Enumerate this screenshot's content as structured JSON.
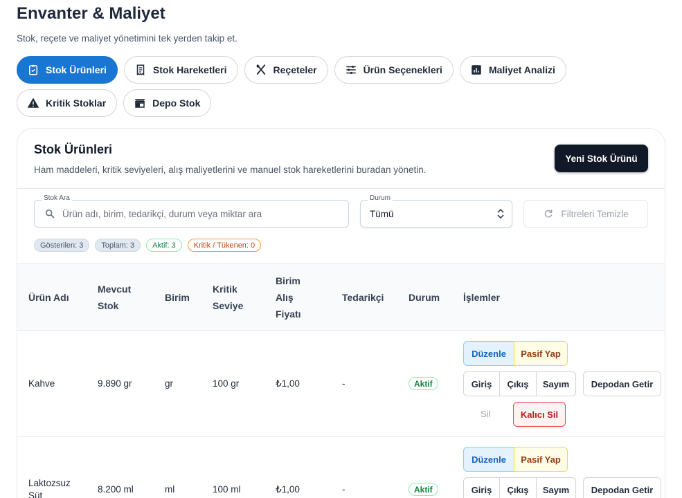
{
  "page": {
    "title": "Envanter & Maliyet",
    "subtitle": "Stok, reçete ve maliyet yönetimini tek yerden takip et."
  },
  "tabs": [
    {
      "label": "Stok Ürünleri",
      "icon": "clipboard-check-icon",
      "active": true
    },
    {
      "label": "Stok Hareketleri",
      "icon": "receipt-icon"
    },
    {
      "label": "Reçeteler",
      "icon": "fork-knife-icon"
    },
    {
      "label": "Ürün Seçenekleri",
      "icon": "tune-icon"
    },
    {
      "label": "Maliyet Analizi",
      "icon": "bar-chart-icon"
    },
    {
      "label": "Kritik Stoklar",
      "icon": "warning-icon"
    },
    {
      "label": "Depo Stok",
      "icon": "store-icon"
    }
  ],
  "card": {
    "title": "Stok Ürünleri",
    "subtitle": "Ham maddeleri, kritik seviyeleri, alış maliyetlerini ve manuel stok hareketlerini buradan yönetin.",
    "new_button": "Yeni Stok Ürünü"
  },
  "filters": {
    "search_label": "Stok Ara",
    "search_placeholder": "Ürün adı, birim, tedarikçi, durum veya miktar ara",
    "status_label": "Durum",
    "status_value": "Tümü",
    "clear_button": "Filtreleri Temizle"
  },
  "chips": {
    "shown": "Gösterilen: 3",
    "total": "Toplam: 3",
    "active": "Aktif: 3",
    "critical": "Kritik / Tükenen: 0"
  },
  "table": {
    "headers": {
      "name": [
        "Ürün Adı"
      ],
      "stock": [
        "Mevcut",
        "Stok"
      ],
      "unit": [
        "Birim"
      ],
      "critical": [
        "Kritik",
        "Seviye"
      ],
      "price": [
        "Birim",
        "Alış",
        "Fiyatı"
      ],
      "supplier": [
        "Tedarikçi"
      ],
      "status": [
        "Durum"
      ],
      "actions": [
        "İşlemler"
      ]
    },
    "rows": [
      {
        "name": [
          "Kahve"
        ],
        "stock": "9.890 gr",
        "unit": "gr",
        "critical": "100 gr",
        "price": "₺1,00",
        "supplier": "-",
        "status": "Aktif"
      },
      {
        "name": [
          "Laktozsuz",
          "Süt"
        ],
        "stock": "8.200 ml",
        "unit": "ml",
        "critical": "100 ml",
        "price": "₺1,00",
        "supplier": "-",
        "status": "Aktif"
      }
    ],
    "actions": {
      "edit": "Düzenle",
      "deactivate": "Pasif Yap",
      "in": "Giriş",
      "out": "Çıkış",
      "count": "Sayım",
      "from_depot": "Depodan Getir",
      "delete": "Sil",
      "hard_delete": "Kalıcı Sil"
    }
  },
  "colors": {
    "primary": "#1976d2",
    "dark_button": "#111827",
    "success": "#15803d",
    "warning": "#c2410c",
    "danger": "#b91c1c"
  }
}
